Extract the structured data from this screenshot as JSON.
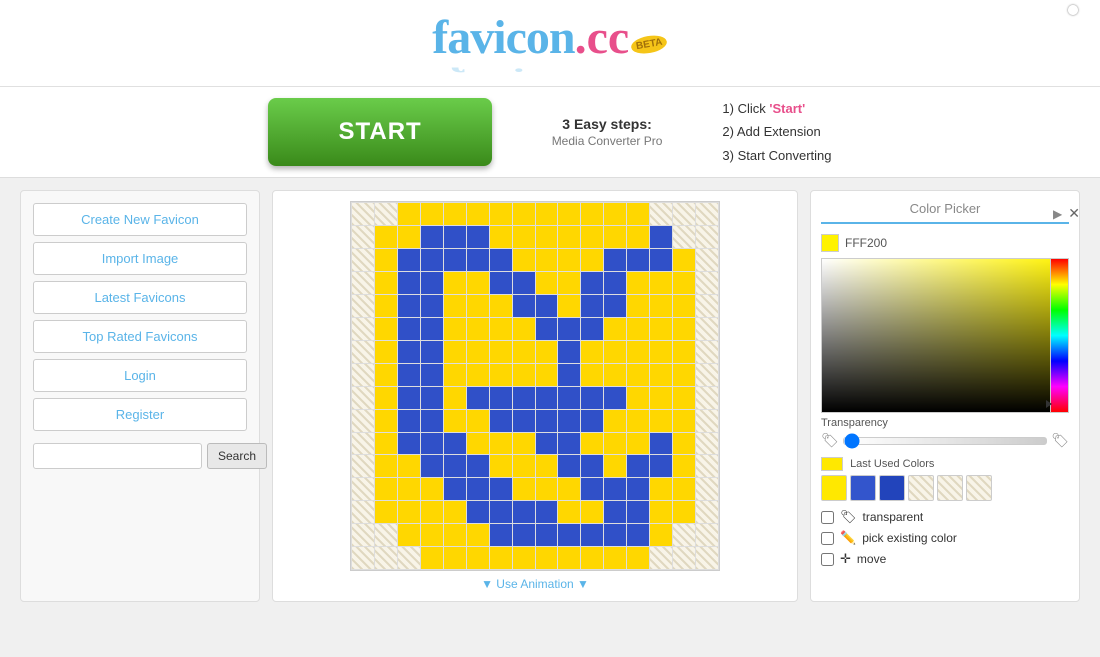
{
  "header": {
    "logo_favicon": "favicon",
    "logo_dotcc": ".cc",
    "logo_beta": "BETA"
  },
  "ad": {
    "start_button": "START",
    "steps_title": "3 Easy steps:",
    "steps_subtitle": "Media Converter Pro",
    "step1": "1) Click",
    "step1_link": "'Start'",
    "step2": "2) Add Extension",
    "step3": "3) Start Converting",
    "close_icon": "▶ ✕"
  },
  "sidebar": {
    "create_favicon": "Create New Favicon",
    "import_image": "Import Image",
    "latest_favicons": "Latest Favicons",
    "top_rated": "Top Rated Favicons",
    "login": "Login",
    "register": "Register",
    "search_placeholder": "",
    "search_button": "Search"
  },
  "canvas": {
    "animation_label": "▼ Use Animation ▼"
  },
  "color_picker": {
    "title": "Color Picker",
    "hex_value": "FFF200",
    "transparency_label": "Transparency",
    "last_used_label": "Last Used Colors",
    "transparent_label": "transparent",
    "pick_existing_label": "pick existing color",
    "move_label": "move",
    "swatches": [
      {
        "color": "#FFE800",
        "name": "yellow"
      },
      {
        "color": "#3355CC",
        "name": "blue1"
      },
      {
        "color": "#2244BB",
        "name": "blue2"
      },
      {
        "color": "#F5E8A0",
        "name": "light-yellow1"
      },
      {
        "color": "#F5E8A0",
        "name": "light-yellow2"
      },
      {
        "color": "#F5E8A0",
        "name": "light-yellow3"
      }
    ]
  },
  "favicon_grid": {
    "rows": 16,
    "cols": 16,
    "cells": [
      "H",
      "H",
      "Y",
      "Y",
      "Y",
      "Y",
      "Y",
      "Y",
      "Y",
      "Y",
      "Y",
      "Y",
      "Y",
      "H",
      "H",
      "H",
      "H",
      "Y",
      "Y",
      "B",
      "B",
      "B",
      "Y",
      "Y",
      "Y",
      "Y",
      "Y",
      "Y",
      "Y",
      "B",
      "H",
      "H",
      "H",
      "Y",
      "B",
      "B",
      "B",
      "B",
      "B",
      "Y",
      "Y",
      "Y",
      "Y",
      "B",
      "B",
      "B",
      "Y",
      "H",
      "H",
      "Y",
      "B",
      "B",
      "Y",
      "Y",
      "B",
      "B",
      "Y",
      "Y",
      "B",
      "B",
      "Y",
      "Y",
      "Y",
      "H",
      "H",
      "Y",
      "B",
      "B",
      "Y",
      "Y",
      "Y",
      "B",
      "B",
      "Y",
      "B",
      "B",
      "Y",
      "Y",
      "Y",
      "H",
      "H",
      "Y",
      "B",
      "B",
      "Y",
      "Y",
      "Y",
      "Y",
      "B",
      "B",
      "B",
      "Y",
      "Y",
      "Y",
      "Y",
      "H",
      "H",
      "Y",
      "B",
      "B",
      "Y",
      "Y",
      "Y",
      "Y",
      "Y",
      "B",
      "Y",
      "Y",
      "Y",
      "Y",
      "Y",
      "H",
      "H",
      "Y",
      "B",
      "B",
      "Y",
      "Y",
      "Y",
      "Y",
      "Y",
      "B",
      "Y",
      "Y",
      "Y",
      "Y",
      "Y",
      "H",
      "H",
      "Y",
      "B",
      "B",
      "Y",
      "B",
      "B",
      "B",
      "B",
      "B",
      "B",
      "B",
      "Y",
      "Y",
      "Y",
      "H",
      "H",
      "Y",
      "B",
      "B",
      "Y",
      "Y",
      "B",
      "B",
      "B",
      "B",
      "B",
      "Y",
      "Y",
      "Y",
      "Y",
      "H",
      "H",
      "Y",
      "B",
      "B",
      "B",
      "Y",
      "Y",
      "Y",
      "B",
      "B",
      "Y",
      "Y",
      "Y",
      "B",
      "Y",
      "H",
      "H",
      "Y",
      "Y",
      "B",
      "B",
      "B",
      "Y",
      "Y",
      "Y",
      "B",
      "B",
      "Y",
      "B",
      "B",
      "Y",
      "H",
      "H",
      "Y",
      "Y",
      "Y",
      "B",
      "B",
      "B",
      "Y",
      "Y",
      "Y",
      "B",
      "B",
      "B",
      "Y",
      "Y",
      "H",
      "H",
      "Y",
      "Y",
      "Y",
      "Y",
      "B",
      "B",
      "B",
      "B",
      "Y",
      "Y",
      "B",
      "B",
      "Y",
      "Y",
      "H",
      "H",
      "H",
      "Y",
      "Y",
      "Y",
      "Y",
      "B",
      "B",
      "B",
      "B",
      "B",
      "B",
      "B",
      "Y",
      "H",
      "H",
      "H",
      "H",
      "H",
      "Y",
      "Y",
      "Y",
      "Y",
      "Y",
      "Y",
      "Y",
      "Y",
      "Y",
      "Y",
      "H",
      "H",
      "H"
    ]
  }
}
